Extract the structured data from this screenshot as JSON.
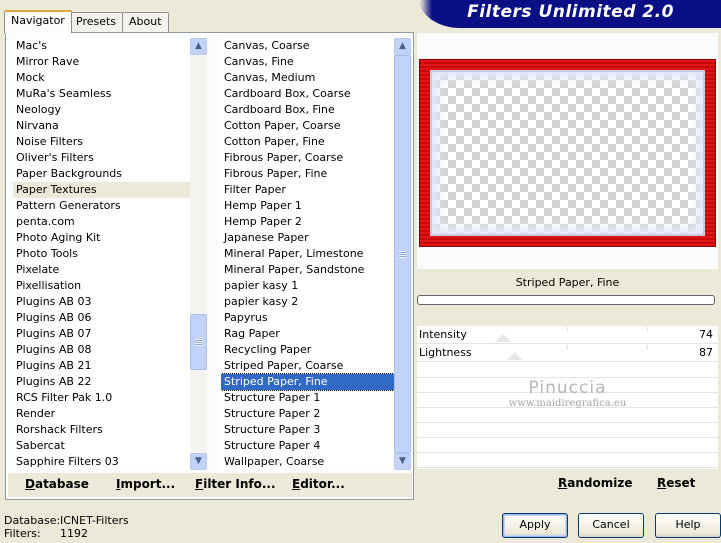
{
  "tabs": [
    "Navigator",
    "Presets",
    "About"
  ],
  "title": "Filters Unlimited 2.0",
  "categories": [
    "Mac's",
    "Mirror Rave",
    "Mock",
    "MuRa's Seamless",
    "Neology",
    "Nirvana",
    "Noise Filters",
    "Oliver's Filters",
    "Paper Backgrounds",
    "Paper Textures",
    "Pattern Generators",
    "penta.com",
    "Photo Aging Kit",
    "Photo Tools",
    "Pixelate",
    "Pixellisation",
    "Plugins AB 03",
    "Plugins AB 06",
    "Plugins AB 07",
    "Plugins AB 08",
    "Plugins AB 21",
    "Plugins AB 22",
    "RCS Filter Pak 1.0",
    "Render",
    "Rorshack Filters",
    "Sabercat",
    "Sapphire Filters 03"
  ],
  "selected_category": "Paper Textures",
  "filters": [
    "Canvas, Coarse",
    "Canvas, Fine",
    "Canvas, Medium",
    "Cardboard Box, Coarse",
    "Cardboard Box, Fine",
    "Cotton Paper, Coarse",
    "Cotton Paper, Fine",
    "Fibrous Paper, Coarse",
    "Fibrous Paper, Fine",
    "Filter Paper",
    "Hemp Paper 1",
    "Hemp Paper 2",
    "Japanese Paper",
    "Mineral Paper, Limestone",
    "Mineral Paper, Sandstone",
    "papier kasy 1",
    "papier kasy 2",
    "Papyrus",
    "Rag Paper",
    "Recycling Paper",
    "Striped Paper, Coarse",
    "Striped Paper, Fine",
    "Structure Paper 1",
    "Structure Paper 2",
    "Structure Paper 3",
    "Structure Paper 4",
    "Wallpaper, Coarse"
  ],
  "selected_filter": "Striped Paper, Fine",
  "left_buttons": {
    "database": "Database",
    "import": "Import...",
    "filter_info": "Filter Info...",
    "editor": "Editor..."
  },
  "preview": {
    "filter_name": "Striped Paper, Fine"
  },
  "sliders": [
    {
      "label": "Intensity",
      "value": "74"
    },
    {
      "label": "Lightness",
      "value": "87"
    }
  ],
  "watermark": {
    "name": "Pinuccia",
    "url": "www.maidiregrafica.eu"
  },
  "right_buttons": {
    "randomize": "Randomize",
    "reset": "Reset"
  },
  "info": {
    "database_label": "Database:",
    "database_value": "ICNET-Filters",
    "filters_label": "Filters:",
    "filters_value": "1192"
  },
  "dialog_buttons": {
    "apply": "Apply",
    "cancel": "Cancel",
    "help": "Help"
  },
  "colors": {
    "banner": "#0b0f86",
    "frame_red": "#e01515",
    "selection": "#316ac5"
  }
}
